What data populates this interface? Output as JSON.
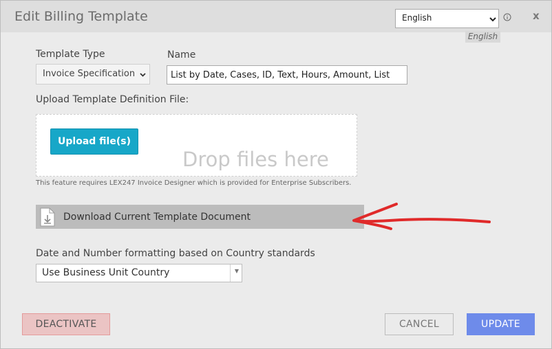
{
  "dialog": {
    "title": "Edit Billing Template",
    "language_select_value": "English",
    "language_badge": "English",
    "close_label": "x"
  },
  "form": {
    "template_type_label": "Template Type",
    "template_type_value": "Invoice Specification",
    "name_label": "Name",
    "name_value": "List by Date, Cases, ID, Text, Hours, Amount, List",
    "upload_label": "Upload Template Definition File:",
    "upload_button": "Upload file(s)",
    "drop_text": "Drop files here",
    "note": "This feature requires LEX247 Invoice Designer which is provided for Enterprise Subscribers.",
    "download_label": "Download Current Template Document",
    "format_label": "Date and Number formatting based on Country standards",
    "format_value": "Use Business Unit Country"
  },
  "footer": {
    "deactivate": "DEACTIVATE",
    "cancel": "CANCEL",
    "update": "UPDATE"
  },
  "colors": {
    "upload_button": "#17a7c8",
    "update_button": "#6e8bea",
    "deactivate_button": "#ebc4c4",
    "annotation_arrow": "#e02a2a"
  }
}
